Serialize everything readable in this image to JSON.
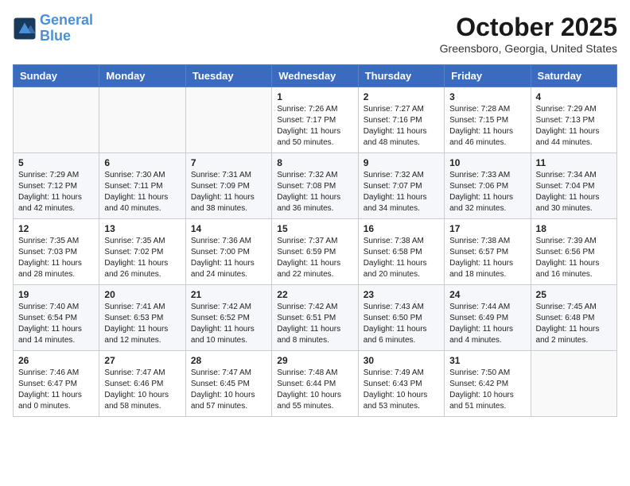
{
  "header": {
    "logo_line1": "General",
    "logo_line2": "Blue",
    "month": "October 2025",
    "location": "Greensboro, Georgia, United States"
  },
  "days_of_week": [
    "Sunday",
    "Monday",
    "Tuesday",
    "Wednesday",
    "Thursday",
    "Friday",
    "Saturday"
  ],
  "weeks": [
    [
      {
        "day": "",
        "info": ""
      },
      {
        "day": "",
        "info": ""
      },
      {
        "day": "",
        "info": ""
      },
      {
        "day": "1",
        "info": "Sunrise: 7:26 AM\nSunset: 7:17 PM\nDaylight: 11 hours\nand 50 minutes."
      },
      {
        "day": "2",
        "info": "Sunrise: 7:27 AM\nSunset: 7:16 PM\nDaylight: 11 hours\nand 48 minutes."
      },
      {
        "day": "3",
        "info": "Sunrise: 7:28 AM\nSunset: 7:15 PM\nDaylight: 11 hours\nand 46 minutes."
      },
      {
        "day": "4",
        "info": "Sunrise: 7:29 AM\nSunset: 7:13 PM\nDaylight: 11 hours\nand 44 minutes."
      }
    ],
    [
      {
        "day": "5",
        "info": "Sunrise: 7:29 AM\nSunset: 7:12 PM\nDaylight: 11 hours\nand 42 minutes."
      },
      {
        "day": "6",
        "info": "Sunrise: 7:30 AM\nSunset: 7:11 PM\nDaylight: 11 hours\nand 40 minutes."
      },
      {
        "day": "7",
        "info": "Sunrise: 7:31 AM\nSunset: 7:09 PM\nDaylight: 11 hours\nand 38 minutes."
      },
      {
        "day": "8",
        "info": "Sunrise: 7:32 AM\nSunset: 7:08 PM\nDaylight: 11 hours\nand 36 minutes."
      },
      {
        "day": "9",
        "info": "Sunrise: 7:32 AM\nSunset: 7:07 PM\nDaylight: 11 hours\nand 34 minutes."
      },
      {
        "day": "10",
        "info": "Sunrise: 7:33 AM\nSunset: 7:06 PM\nDaylight: 11 hours\nand 32 minutes."
      },
      {
        "day": "11",
        "info": "Sunrise: 7:34 AM\nSunset: 7:04 PM\nDaylight: 11 hours\nand 30 minutes."
      }
    ],
    [
      {
        "day": "12",
        "info": "Sunrise: 7:35 AM\nSunset: 7:03 PM\nDaylight: 11 hours\nand 28 minutes."
      },
      {
        "day": "13",
        "info": "Sunrise: 7:35 AM\nSunset: 7:02 PM\nDaylight: 11 hours\nand 26 minutes."
      },
      {
        "day": "14",
        "info": "Sunrise: 7:36 AM\nSunset: 7:00 PM\nDaylight: 11 hours\nand 24 minutes."
      },
      {
        "day": "15",
        "info": "Sunrise: 7:37 AM\nSunset: 6:59 PM\nDaylight: 11 hours\nand 22 minutes."
      },
      {
        "day": "16",
        "info": "Sunrise: 7:38 AM\nSunset: 6:58 PM\nDaylight: 11 hours\nand 20 minutes."
      },
      {
        "day": "17",
        "info": "Sunrise: 7:38 AM\nSunset: 6:57 PM\nDaylight: 11 hours\nand 18 minutes."
      },
      {
        "day": "18",
        "info": "Sunrise: 7:39 AM\nSunset: 6:56 PM\nDaylight: 11 hours\nand 16 minutes."
      }
    ],
    [
      {
        "day": "19",
        "info": "Sunrise: 7:40 AM\nSunset: 6:54 PM\nDaylight: 11 hours\nand 14 minutes."
      },
      {
        "day": "20",
        "info": "Sunrise: 7:41 AM\nSunset: 6:53 PM\nDaylight: 11 hours\nand 12 minutes."
      },
      {
        "day": "21",
        "info": "Sunrise: 7:42 AM\nSunset: 6:52 PM\nDaylight: 11 hours\nand 10 minutes."
      },
      {
        "day": "22",
        "info": "Sunrise: 7:42 AM\nSunset: 6:51 PM\nDaylight: 11 hours\nand 8 minutes."
      },
      {
        "day": "23",
        "info": "Sunrise: 7:43 AM\nSunset: 6:50 PM\nDaylight: 11 hours\nand 6 minutes."
      },
      {
        "day": "24",
        "info": "Sunrise: 7:44 AM\nSunset: 6:49 PM\nDaylight: 11 hours\nand 4 minutes."
      },
      {
        "day": "25",
        "info": "Sunrise: 7:45 AM\nSunset: 6:48 PM\nDaylight: 11 hours\nand 2 minutes."
      }
    ],
    [
      {
        "day": "26",
        "info": "Sunrise: 7:46 AM\nSunset: 6:47 PM\nDaylight: 11 hours\nand 0 minutes."
      },
      {
        "day": "27",
        "info": "Sunrise: 7:47 AM\nSunset: 6:46 PM\nDaylight: 10 hours\nand 58 minutes."
      },
      {
        "day": "28",
        "info": "Sunrise: 7:47 AM\nSunset: 6:45 PM\nDaylight: 10 hours\nand 57 minutes."
      },
      {
        "day": "29",
        "info": "Sunrise: 7:48 AM\nSunset: 6:44 PM\nDaylight: 10 hours\nand 55 minutes."
      },
      {
        "day": "30",
        "info": "Sunrise: 7:49 AM\nSunset: 6:43 PM\nDaylight: 10 hours\nand 53 minutes."
      },
      {
        "day": "31",
        "info": "Sunrise: 7:50 AM\nSunset: 6:42 PM\nDaylight: 10 hours\nand 51 minutes."
      },
      {
        "day": "",
        "info": ""
      }
    ]
  ]
}
